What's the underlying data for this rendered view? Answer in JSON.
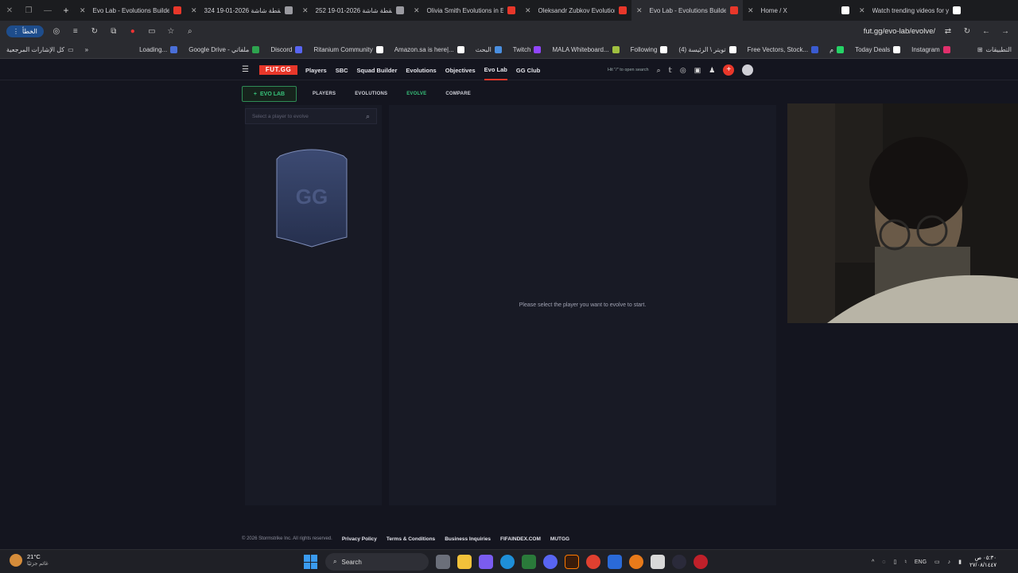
{
  "browser": {
    "tabs": [
      {
        "title": "Evo Lab - Evolutions Builder",
        "favicon_color": "#e8372a",
        "active": false
      },
      {
        "title": "لقطة شاشة 2026-01-19 324",
        "favicon_color": "#9a9aa0",
        "active": false
      },
      {
        "title": "لقطة شاشة 2026-01-19 252",
        "favicon_color": "#9a9aa0",
        "active": false
      },
      {
        "title": "Olivia Smith Evolutions in EA",
        "favicon_color": "#e8372a",
        "active": false
      },
      {
        "title": "Oleksandr Zubkov Evolution",
        "favicon_color": "#e8372a",
        "active": false
      },
      {
        "title": "Evo Lab - Evolutions Builder",
        "favicon_color": "#e8372a",
        "active": true
      },
      {
        "title": "Home / X",
        "favicon_color": "#ffffff",
        "active": false
      },
      {
        "title": "Watch trending videos for yo",
        "favicon_color": "#ffffff",
        "active": false
      }
    ],
    "new_tab": "+",
    "profile_label": "الخطأ",
    "url": "fut.gg/evo-lab/evolve/",
    "bookmarks_all": "كل الإشارات المرجعية",
    "bookmarks_apps": "التطبيقات",
    "bookmarks": [
      {
        "label": "Loading...",
        "color": "#4a6fd8"
      },
      {
        "label": "Google Drive - ملفاتي",
        "color": "#2ea44f"
      },
      {
        "label": "Discord",
        "color": "#5865f2"
      },
      {
        "label": "Ritanium Community",
        "color": "#ffffff"
      },
      {
        "label": "Amazon.sa is here|...",
        "color": "#ffffff"
      },
      {
        "label": "البحث",
        "color": "#4a8fe0"
      },
      {
        "label": "Twitch",
        "color": "#9146ff"
      },
      {
        "label": "MALA Whiteboard...",
        "color": "#a0c040"
      },
      {
        "label": "Following",
        "color": "#ffffff"
      },
      {
        "label": "(4) تويتر \\ الرئيسة",
        "color": "#ffffff"
      },
      {
        "label": "Free Vectors, Stock...",
        "color": "#3a5bd0"
      },
      {
        "label": "م",
        "color": "#25d366"
      },
      {
        "label": "Today Deals",
        "color": "#ffffff"
      },
      {
        "label": "Instagram",
        "color": "#e1306c"
      }
    ]
  },
  "site": {
    "logo": "FUT.GG",
    "nav": [
      "Players",
      "SBC",
      "Squad Builder",
      "Evolutions",
      "Objectives",
      "Evo Lab",
      "GG Club"
    ],
    "search_hint": "Hit \"/\" to open search",
    "subnav": {
      "evo_button": "EVO LAB",
      "tabs": [
        "PLAYERS",
        "EVOLUTIONS",
        "EVOLVE",
        "COMPARE"
      ]
    },
    "search_placeholder": "Select a player to evolve",
    "card_watermark": "GG",
    "empty_message": "Please select the player you want to evolve to start.",
    "footer": {
      "copyright": "© 2026 Stormstrike Inc. All rights reserved.",
      "links": [
        "Privacy Policy",
        "Terms & Conditions",
        "Business Inquiries",
        "FIFAINDEX.COM",
        "MUTGG"
      ]
    }
  },
  "taskbar": {
    "temperature": "21°C",
    "weather_sub": "غائم جزئيًا",
    "search_label": "Search",
    "language": "ENG",
    "time": "٠٥:٣٠ ص",
    "date": "٢٧/٠٨/١٤٤٧"
  },
  "colors": {
    "accent_red": "#e8372a",
    "accent_green": "#37c27a",
    "background": "#14151f"
  }
}
